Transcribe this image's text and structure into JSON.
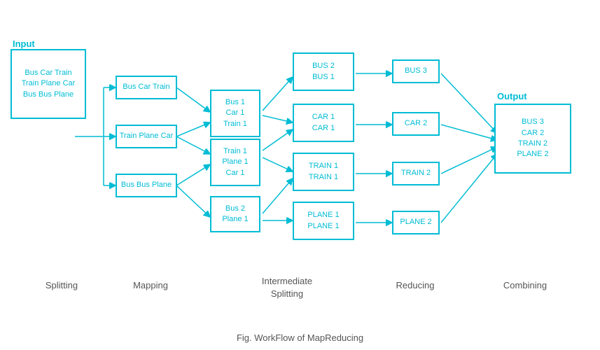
{
  "labels": {
    "input": "Input",
    "output": "Output",
    "splitting": "Splitting",
    "mapping": "Mapping",
    "intermediate_splitting": "Intermediate\nSplitting",
    "reducing": "Reducing",
    "combining": "Combining",
    "fig": "Fig. WorkFlow of MapReducing"
  },
  "nodes": {
    "input": "Bus Car Train\nTrain Plane Car\nBus Bus Plane",
    "map1": "Bus Car Train",
    "map2": "Train Plane Car",
    "map3": "Bus Bus Plane",
    "inter1": "Bus 1\nCar 1\nTrain 1",
    "inter2": "Train 1\nPlane 1\nCar 1",
    "inter3": "Bus 2\nPlane 1",
    "is1": "BUS 2\nBUS 1",
    "is2": "CAR 1\nCAR 1",
    "is3": "TRAIN 1\nTRAIN 1",
    "is4": "PLANE 1\nPLANE 1",
    "red1": "BUS 3",
    "red2": "CAR 2",
    "red3": "TRAIN 2",
    "red4": "PLANE 2",
    "output": "BUS 3\nCAR 2\nTRAIN 2\nPLANE 2"
  }
}
